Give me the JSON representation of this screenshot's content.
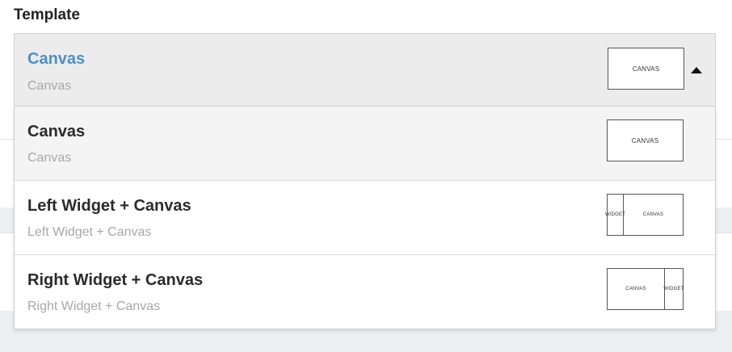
{
  "field": {
    "label": "Template"
  },
  "selected": {
    "title": "Canvas",
    "subtitle": "Canvas",
    "thumb": {
      "canvas": "CANVAS"
    }
  },
  "options": [
    {
      "title": "Canvas",
      "subtitle": "Canvas",
      "thumb": {
        "canvas": "CANVAS"
      }
    },
    {
      "title": "Left Widget + Canvas",
      "subtitle": "Left Widget + Canvas",
      "thumb": {
        "widget": "WIDGET",
        "canvas": "CANVAS"
      }
    },
    {
      "title": "Right Widget + Canvas",
      "subtitle": "Right Widget + Canvas",
      "thumb": {
        "canvas": "CANVAS",
        "widget": "WIDGET"
      }
    }
  ],
  "colors": {
    "selected_title": "#4a90c8",
    "caret": "#111111"
  },
  "icons": {
    "toggle": "caret-up-icon"
  }
}
